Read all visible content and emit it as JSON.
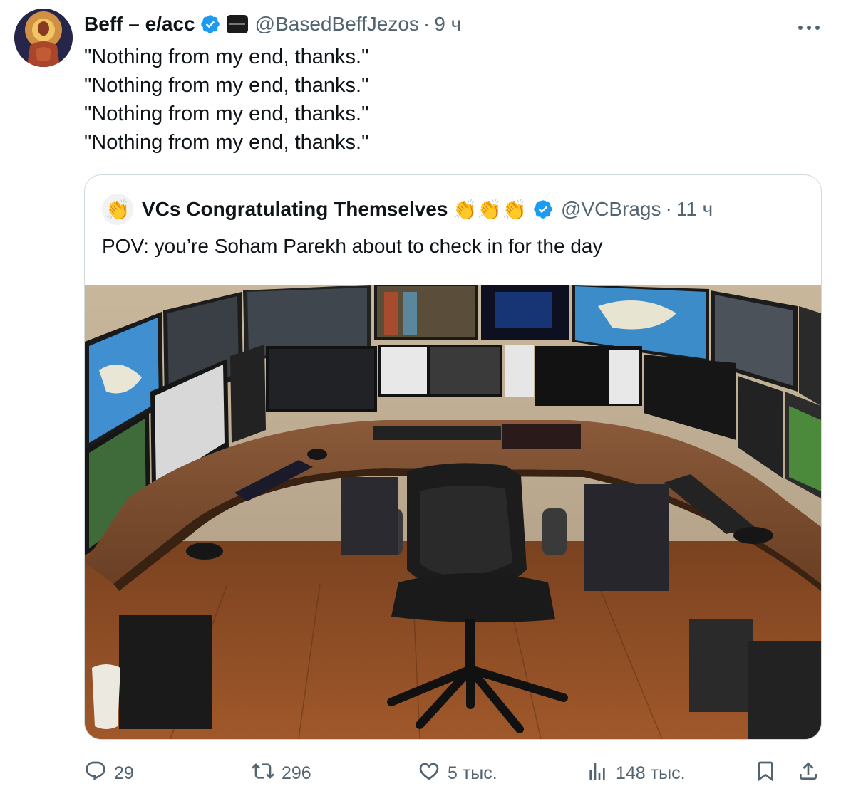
{
  "tweet": {
    "author": {
      "display_name": "Beff – e/acc",
      "handle": "@BasedBeffJezos",
      "time": "9 ч",
      "separator": "·",
      "verified": true
    },
    "more_icon": "more-horizontal-icon",
    "text_lines": [
      "\"Nothing from my end, thanks.\"",
      "\"Nothing from my end, thanks.\"",
      "\"Nothing from my end, thanks.\"",
      "\"Nothing from my end, thanks.\""
    ]
  },
  "quote": {
    "author": {
      "display_name": "VCs Congratulating Themselves",
      "claps": "👏👏👏",
      "avatar_emoji": "👏",
      "handle": "@VCBrags",
      "separator": "·",
      "time": "11 ч",
      "verified": true
    },
    "text": "POV: you’re Soham Parekh about to check in for the day"
  },
  "actions": {
    "reply_count": "29",
    "retweet_count": "296",
    "like_count": "5 тыс.",
    "views_count": "148 тыс."
  },
  "colors": {
    "verified": "#1d9bf0",
    "muted": "#536471",
    "text": "#0f1419",
    "border": "#cfd9de"
  }
}
